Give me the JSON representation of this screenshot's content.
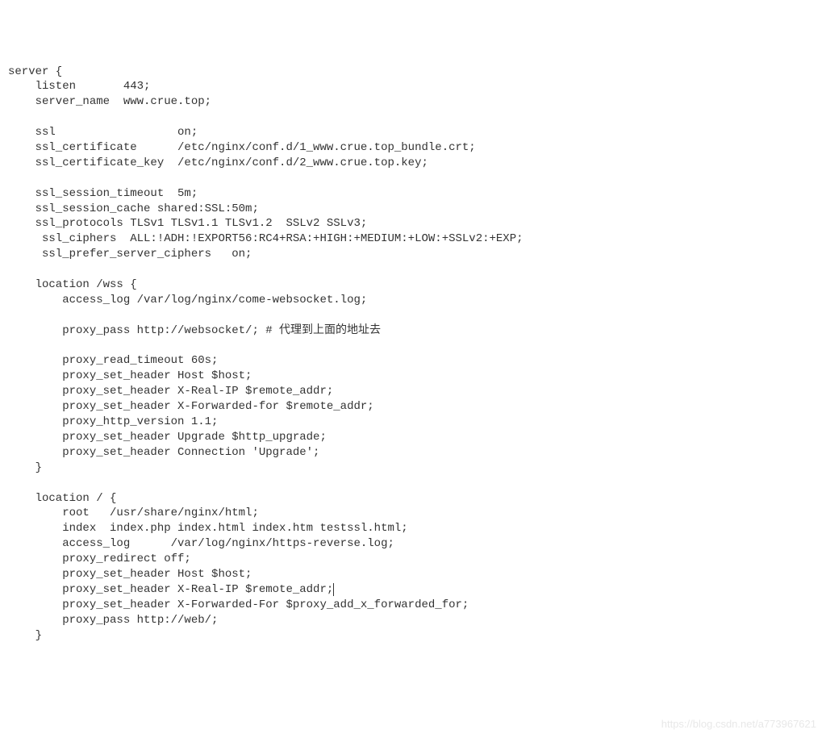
{
  "config": {
    "lines": [
      "server {",
      "    listen       443;",
      "    server_name  www.crue.top;",
      "",
      "    ssl                  on;",
      "    ssl_certificate      /etc/nginx/conf.d/1_www.crue.top_bundle.crt;",
      "    ssl_certificate_key  /etc/nginx/conf.d/2_www.crue.top.key;",
      "",
      "    ssl_session_timeout  5m;",
      "    ssl_session_cache shared:SSL:50m;",
      "    ssl_protocols TLSv1 TLSv1.1 TLSv1.2  SSLv2 SSLv3;",
      "     ssl_ciphers  ALL:!ADH:!EXPORT56:RC4+RSA:+HIGH:+MEDIUM:+LOW:+SSLv2:+EXP;",
      "     ssl_prefer_server_ciphers   on;",
      "",
      "    location /wss {",
      "        access_log /var/log/nginx/come-websocket.log;",
      "",
      "        proxy_pass http://websocket/; # 代理到上面的地址去",
      "",
      "        proxy_read_timeout 60s;",
      "        proxy_set_header Host $host;",
      "        proxy_set_header X-Real-IP $remote_addr;",
      "        proxy_set_header X-Forwarded-for $remote_addr;",
      "        proxy_http_version 1.1;",
      "        proxy_set_header Upgrade $http_upgrade;",
      "        proxy_set_header Connection 'Upgrade';",
      "    }",
      "",
      "    location / {",
      "        root   /usr/share/nginx/html;",
      "        index  index.php index.html index.htm testssl.html;",
      "        access_log      /var/log/nginx/https-reverse.log;",
      "        proxy_redirect off;",
      "        proxy_set_header Host $host;",
      "        proxy_set_header X-Real-IP $remote_addr;",
      "        proxy_set_header X-Forwarded-For $proxy_add_x_forwarded_for;",
      "        proxy_pass http://web/;",
      "    }"
    ]
  },
  "watermark": "https://blog.csdn.net/a773967621",
  "cursor_line_index": 34
}
